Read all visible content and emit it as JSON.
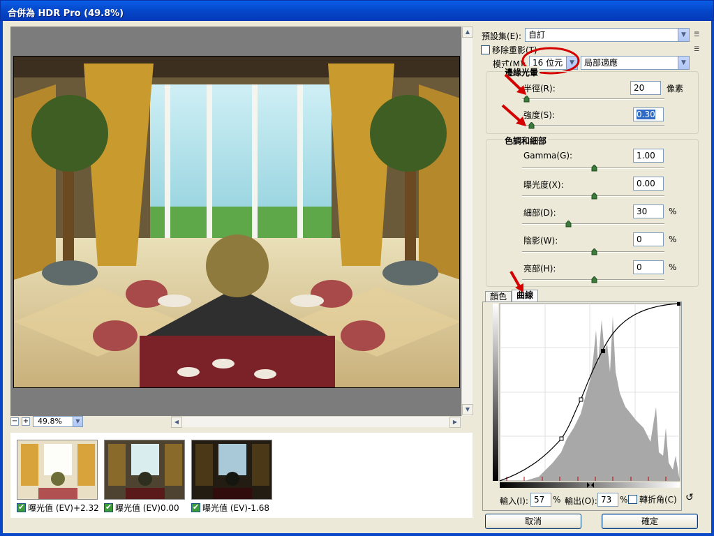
{
  "window": {
    "title": "合併為 HDR Pro (49.8%)"
  },
  "preview": {
    "zoom": "49.8%"
  },
  "thumbnails": [
    {
      "label": "曝光值 (EV)+2.32",
      "checked": true
    },
    {
      "label": "曝光值 (EV)0.00",
      "checked": true
    },
    {
      "label": "曝光值 (EV)-1.68",
      "checked": true
    }
  ],
  "panel": {
    "preset_label": "預設集(E):",
    "preset_value": "自訂",
    "remove_ghost_label": "移除重影(T)",
    "mode_label": "模式(M):",
    "bit_value": "16 位元",
    "method_value": "局部適應",
    "edge_glow": {
      "title": "邊緣光暈",
      "radius_label": "半徑(R):",
      "radius_value": "20",
      "radius_unit": "像素",
      "strength_label": "強度(S):",
      "strength_value": "0.30"
    },
    "tone_detail": {
      "title": "色調和細部",
      "gamma_label": "Gamma(G):",
      "gamma_value": "1.00",
      "exposure_label": "曝光度(X):",
      "exposure_value": "0.00",
      "detail_label": "細部(D):",
      "detail_value": "30",
      "detail_unit": "%",
      "shadow_label": "陰影(W):",
      "shadow_value": "0",
      "shadow_unit": "%",
      "highlight_label": "亮部(H):",
      "highlight_value": "0",
      "highlight_unit": "%"
    },
    "tabs": [
      "顏色",
      "曲線"
    ],
    "curve": {
      "input_label": "輸入(I):",
      "input_value": "57",
      "input_unit": "%",
      "output_label": "輸出(O):",
      "output_value": "73",
      "output_unit": "%",
      "corner_label": "轉折角(C)"
    },
    "cancel": "取消",
    "ok": "確定"
  },
  "colors": {
    "title": "#0a5ee8",
    "accent": "#d40000"
  }
}
